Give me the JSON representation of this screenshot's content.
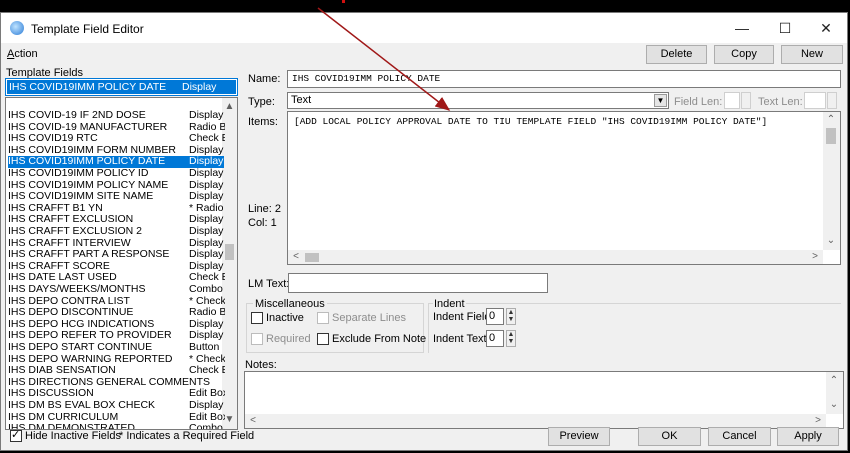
{
  "window": {
    "title": "Template Field Editor"
  },
  "titlebar": {
    "minimize": "—",
    "maximize": "☐",
    "close": "✕"
  },
  "menu": {
    "action": "Action"
  },
  "toolbar": {
    "delete": "Delete",
    "copy": "Copy",
    "new": "New"
  },
  "left": {
    "label": "Template Fields",
    "selected_name": "IHS COVID19IMM POLICY DATE",
    "selected_type": "Display Text",
    "items": [
      {
        "name": "IHS COVID-19 IF 2ND DOSE",
        "type": "Display T"
      },
      {
        "name": "IHS COVID-19 MANUFACTURER",
        "type": "Radio Bu"
      },
      {
        "name": "IHS COVID19 RTC",
        "type": "Check B"
      },
      {
        "name": "IHS COVID19IMM FORM NUMBER",
        "type": "Display T"
      },
      {
        "name": "IHS COVID19IMM POLICY DATE",
        "type": "Display T"
      },
      {
        "name": "IHS COVID19IMM POLICY ID",
        "type": "Display T"
      },
      {
        "name": "IHS COVID19IMM POLICY NAME",
        "type": "Display T"
      },
      {
        "name": "IHS COVID19IMM SITE NAME",
        "type": "Display T"
      },
      {
        "name": "IHS CRAFFT B1 YN",
        "type": "* Radio B"
      },
      {
        "name": "IHS CRAFFT EXCLUSION",
        "type": "Display T"
      },
      {
        "name": "IHS CRAFFT EXCLUSION 2",
        "type": "Display T"
      },
      {
        "name": "IHS CRAFFT INTERVIEW",
        "type": "Display T"
      },
      {
        "name": "IHS CRAFFT PART A RESPONSE",
        "type": "Display T"
      },
      {
        "name": "IHS CRAFFT SCORE",
        "type": "Display T"
      },
      {
        "name": "IHS DATE LAST USED",
        "type": "Check B"
      },
      {
        "name": "IHS DAYS/WEEKS/MONTHS",
        "type": "Combo B"
      },
      {
        "name": "IHS DEPO CONTRA LIST",
        "type": "* Check B"
      },
      {
        "name": "IHS DEPO DISCONTINUE",
        "type": "Radio Bu"
      },
      {
        "name": "IHS DEPO HCG INDICATIONS",
        "type": "Display T"
      },
      {
        "name": "IHS DEPO REFER TO PROVIDER",
        "type": "Display T"
      },
      {
        "name": "IHS DEPO START CONTINUE",
        "type": "Button"
      },
      {
        "name": "IHS DEPO WARNING REPORTED",
        "type": "* Check B"
      },
      {
        "name": "IHS DIAB SENSATION",
        "type": "Check B"
      },
      {
        "name": "IHS DIRECTIONS GENERAL COMMENTS",
        "type": ""
      },
      {
        "name": "IHS DISCUSSION",
        "type": "Edit Box"
      },
      {
        "name": "IHS DM BS EVAL BOX CHECK",
        "type": "Display T"
      },
      {
        "name": "IHS DM CURRICULUM",
        "type": "Edit Box"
      },
      {
        "name": "IHS DM DEMONSTRATED",
        "type": "Combo B"
      }
    ]
  },
  "form": {
    "name_label": "Name:",
    "name_value": "IHS COVID19IMM POLICY DATE",
    "type_label": "Type:",
    "type_value": "Text",
    "field_len_label": "Field Len:",
    "text_len_label": "Text Len:",
    "items_label": "Items:",
    "items_value": "[ADD LOCAL POLICY APPROVAL DATE TO TIU TEMPLATE FIELD \"IHS COVID19IMM POLICY DATE\"]",
    "line_label": "Line: 2",
    "col_label": "Col: 1",
    "lm_text_label": "LM Text:",
    "lm_text_value": ""
  },
  "misc": {
    "group_label": "Miscellaneous",
    "inactive": "Inactive",
    "separate_lines": "Separate Lines",
    "required": "Required",
    "exclude_from_note": "Exclude From Note"
  },
  "indent": {
    "group_label": "Indent",
    "indent_field_label": "Indent Field:",
    "indent_field_value": "0",
    "indent_text_label": "Indent Text:",
    "indent_text_value": "0"
  },
  "notes": {
    "label": "Notes:",
    "value": ""
  },
  "bottom": {
    "hide_inactive": "Hide Inactive Fields",
    "required_hint": "* Indicates a Required Field",
    "preview": "Preview",
    "ok": "OK",
    "cancel": "Cancel",
    "apply": "Apply"
  },
  "colors": {
    "selection": "#0078d7",
    "annotation_arrow": "#a01818"
  }
}
